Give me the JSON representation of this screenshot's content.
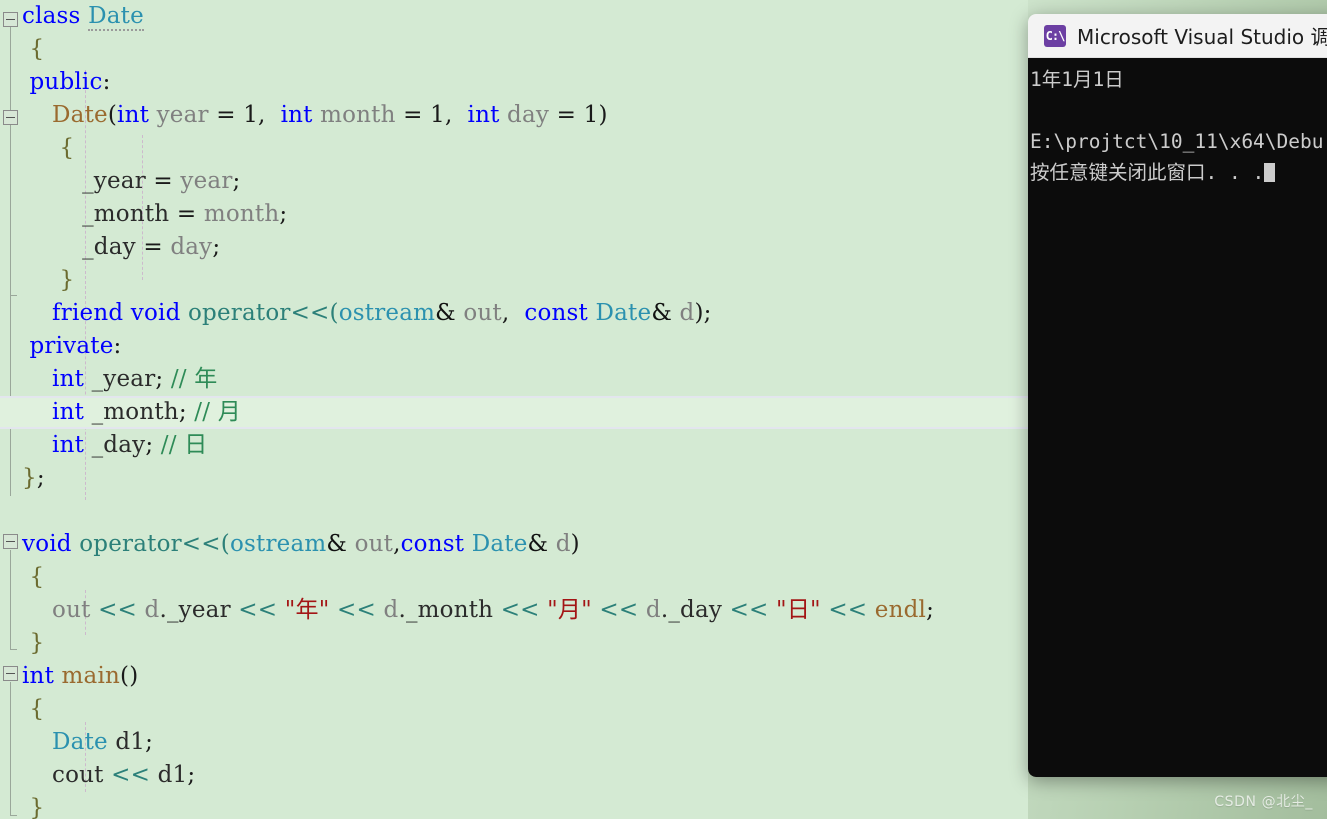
{
  "editor": {
    "background_color": "#d4ead3",
    "current_line_background": "#e0f1de",
    "lines": [
      {
        "indent": 0,
        "tokens": [
          {
            "t": "class ",
            "c": "kw"
          },
          {
            "t": "Date",
            "c": "sqig"
          }
        ]
      },
      {
        "indent": 0,
        "tokens": [
          {
            "t": " {",
            "c": "brace"
          }
        ]
      },
      {
        "indent": 0,
        "tokens": [
          {
            "t": " public",
            "c": "kw"
          },
          {
            "t": ":",
            "c": "punc"
          }
        ]
      },
      {
        "indent": 0,
        "tokens": [
          {
            "t": "    ",
            "c": "plain"
          },
          {
            "t": "Date",
            "c": "fn"
          },
          {
            "t": "(",
            "c": "punc"
          },
          {
            "t": "int",
            "c": "kw"
          },
          {
            "t": " year",
            "c": "ident"
          },
          {
            "t": " = ",
            "c": "punc"
          },
          {
            "t": "1",
            "c": "num"
          },
          {
            "t": ",  ",
            "c": "punc"
          },
          {
            "t": "int",
            "c": "kw"
          },
          {
            "t": " month",
            "c": "ident"
          },
          {
            "t": " = ",
            "c": "punc"
          },
          {
            "t": "1",
            "c": "num"
          },
          {
            "t": ",  ",
            "c": "punc"
          },
          {
            "t": "int",
            "c": "kw"
          },
          {
            "t": " day",
            "c": "ident"
          },
          {
            "t": " = ",
            "c": "punc"
          },
          {
            "t": "1",
            "c": "num"
          },
          {
            "t": ")",
            "c": "punc"
          }
        ]
      },
      {
        "indent": 0,
        "tokens": [
          {
            "t": "     {",
            "c": "brace"
          }
        ]
      },
      {
        "indent": 0,
        "tokens": [
          {
            "t": "        _year",
            "c": "plain"
          },
          {
            "t": " = ",
            "c": "punc"
          },
          {
            "t": "year",
            "c": "ident"
          },
          {
            "t": ";",
            "c": "punc"
          }
        ]
      },
      {
        "indent": 0,
        "tokens": [
          {
            "t": "        _month",
            "c": "plain"
          },
          {
            "t": " = ",
            "c": "punc"
          },
          {
            "t": "month",
            "c": "ident"
          },
          {
            "t": ";",
            "c": "punc"
          }
        ]
      },
      {
        "indent": 0,
        "tokens": [
          {
            "t": "        _day",
            "c": "plain"
          },
          {
            "t": " = ",
            "c": "punc"
          },
          {
            "t": "day",
            "c": "ident"
          },
          {
            "t": ";",
            "c": "punc"
          }
        ]
      },
      {
        "indent": 0,
        "tokens": [
          {
            "t": "     }",
            "c": "brace"
          }
        ]
      },
      {
        "indent": 0,
        "tokens": [
          {
            "t": "    ",
            "c": "plain"
          },
          {
            "t": "friend void ",
            "c": "kw"
          },
          {
            "t": "operator<<",
            "c": "op"
          },
          {
            "t": "(",
            "c": "op"
          },
          {
            "t": "ostream",
            "c": "type"
          },
          {
            "t": "&",
            "c": "amp"
          },
          {
            "t": " out",
            "c": "ident"
          },
          {
            "t": ",  ",
            "c": "punc"
          },
          {
            "t": "const",
            "c": "kw"
          },
          {
            "t": " ",
            "c": "plain"
          },
          {
            "t": "Date",
            "c": "type"
          },
          {
            "t": "&",
            "c": "amp"
          },
          {
            "t": " d",
            "c": "ident"
          },
          {
            "t": ")",
            "c": "punc"
          },
          {
            "t": ";",
            "c": "punc"
          }
        ]
      },
      {
        "indent": 0,
        "tokens": [
          {
            "t": " private",
            "c": "kw"
          },
          {
            "t": ":",
            "c": "punc"
          }
        ]
      },
      {
        "indent": 0,
        "tokens": [
          {
            "t": "    ",
            "c": "plain"
          },
          {
            "t": "int",
            "c": "kw"
          },
          {
            "t": " _year",
            "c": "plain"
          },
          {
            "t": "; ",
            "c": "punc"
          },
          {
            "t": "// 年",
            "c": "cmt"
          }
        ]
      },
      {
        "indent": 0,
        "current": true,
        "tokens": [
          {
            "t": "    ",
            "c": "plain"
          },
          {
            "t": "int",
            "c": "kw"
          },
          {
            "t": " _month",
            "c": "plain"
          },
          {
            "t": "; ",
            "c": "punc"
          },
          {
            "t": "// 月",
            "c": "cmt"
          }
        ]
      },
      {
        "indent": 0,
        "tokens": [
          {
            "t": "    ",
            "c": "plain"
          },
          {
            "t": "int",
            "c": "kw"
          },
          {
            "t": " _day",
            "c": "plain"
          },
          {
            "t": "; ",
            "c": "punc"
          },
          {
            "t": "// 日",
            "c": "cmt"
          }
        ]
      },
      {
        "indent": 0,
        "tokens": [
          {
            "t": "}",
            "c": "brace"
          },
          {
            "t": ";",
            "c": "punc"
          }
        ]
      },
      {
        "indent": 0,
        "tokens": [
          {
            "t": " ",
            "c": "plain"
          }
        ]
      },
      {
        "indent": 0,
        "tokens": [
          {
            "t": "void ",
            "c": "kw"
          },
          {
            "t": "operator<<",
            "c": "op"
          },
          {
            "t": "(",
            "c": "op"
          },
          {
            "t": "ostream",
            "c": "type"
          },
          {
            "t": "&",
            "c": "amp"
          },
          {
            "t": " out",
            "c": "ident"
          },
          {
            "t": ",",
            "c": "punc"
          },
          {
            "t": "const",
            "c": "kw"
          },
          {
            "t": " ",
            "c": "plain"
          },
          {
            "t": "Date",
            "c": "type"
          },
          {
            "t": "&",
            "c": "amp"
          },
          {
            "t": " d",
            "c": "ident"
          },
          {
            "t": ")",
            "c": "punc"
          }
        ]
      },
      {
        "indent": 0,
        "tokens": [
          {
            "t": " {",
            "c": "brace"
          }
        ]
      },
      {
        "indent": 0,
        "tokens": [
          {
            "t": "    out",
            "c": "ident"
          },
          {
            "t": " << ",
            "c": "op"
          },
          {
            "t": "d",
            "c": "ident"
          },
          {
            "t": "._year",
            "c": "plain"
          },
          {
            "t": " << ",
            "c": "op"
          },
          {
            "t": "\"年\"",
            "c": "str"
          },
          {
            "t": " << ",
            "c": "op"
          },
          {
            "t": "d",
            "c": "ident"
          },
          {
            "t": "._month",
            "c": "plain"
          },
          {
            "t": " << ",
            "c": "op"
          },
          {
            "t": "\"月\"",
            "c": "str"
          },
          {
            "t": " << ",
            "c": "op"
          },
          {
            "t": "d",
            "c": "ident"
          },
          {
            "t": "._day",
            "c": "plain"
          },
          {
            "t": " << ",
            "c": "op"
          },
          {
            "t": "\"日\"",
            "c": "str"
          },
          {
            "t": " << ",
            "c": "op"
          },
          {
            "t": "endl",
            "c": "fn"
          },
          {
            "t": ";",
            "c": "punc"
          }
        ]
      },
      {
        "indent": 0,
        "tokens": [
          {
            "t": " }",
            "c": "brace"
          }
        ]
      },
      {
        "indent": 0,
        "tokens": [
          {
            "t": "int ",
            "c": "kw"
          },
          {
            "t": "main",
            "c": "fn"
          },
          {
            "t": "()",
            "c": "punc"
          }
        ]
      },
      {
        "indent": 0,
        "tokens": [
          {
            "t": " {",
            "c": "brace"
          }
        ]
      },
      {
        "indent": 0,
        "tokens": [
          {
            "t": "    ",
            "c": "plain"
          },
          {
            "t": "Date",
            "c": "type"
          },
          {
            "t": " d1",
            "c": "plain"
          },
          {
            "t": ";",
            "c": "punc"
          }
        ]
      },
      {
        "indent": 0,
        "tokens": [
          {
            "t": "    cout",
            "c": "plain"
          },
          {
            "t": " << ",
            "c": "op"
          },
          {
            "t": "d1",
            "c": "plain"
          },
          {
            "t": ";",
            "c": "punc"
          }
        ]
      },
      {
        "indent": 0,
        "tokens": [
          {
            "t": " }",
            "c": "brace"
          }
        ]
      }
    ]
  },
  "console": {
    "title": "Microsoft Visual Studio 调试控制",
    "icon": "console-icon",
    "icon_glyph": "C:\\",
    "icon_color": "#6c3fa3",
    "background_color": "#0c0c0c",
    "text_color": "#cccccc",
    "lines": [
      "1年1月1日",
      "",
      "E:\\projtct\\10_11\\x64\\Debu",
      "按任意键关闭此窗口. . ."
    ]
  },
  "watermark": {
    "text": "CSDN @北尘_"
  }
}
